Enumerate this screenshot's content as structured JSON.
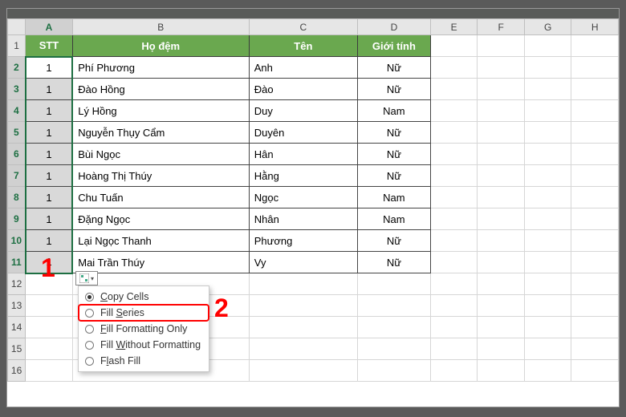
{
  "columns": [
    "A",
    "B",
    "C",
    "D",
    "E",
    "F",
    "G",
    "H"
  ],
  "rowNumbers": [
    1,
    2,
    3,
    4,
    5,
    6,
    7,
    8,
    9,
    10,
    11,
    12,
    13,
    14,
    15,
    16
  ],
  "headers": {
    "stt": "STT",
    "hodem": "Họ đệm",
    "ten": "Tên",
    "gioitinh": "Giới tính"
  },
  "rows": [
    {
      "stt": "1",
      "hodem": "Phí Phương",
      "ten": "Anh",
      "gt": "Nữ"
    },
    {
      "stt": "1",
      "hodem": "Đào Hồng",
      "ten": "Đào",
      "gt": "Nữ"
    },
    {
      "stt": "1",
      "hodem": "Lý Hồng",
      "ten": "Duy",
      "gt": "Nam"
    },
    {
      "stt": "1",
      "hodem": "Nguyễn Thụy Cẩm",
      "ten": "Duyên",
      "gt": "Nữ"
    },
    {
      "stt": "1",
      "hodem": "Bùi Ngọc",
      "ten": "Hân",
      "gt": "Nữ"
    },
    {
      "stt": "1",
      "hodem": "Hoàng Thị Thúy",
      "ten": "Hằng",
      "gt": "Nữ"
    },
    {
      "stt": "1",
      "hodem": "Chu Tuấn",
      "ten": "Ngọc",
      "gt": "Nam"
    },
    {
      "stt": "1",
      "hodem": "Đặng Ngọc",
      "ten": "Nhân",
      "gt": "Nam"
    },
    {
      "stt": "1",
      "hodem": "Lại Ngọc Thanh",
      "ten": "Phương",
      "gt": "Nữ"
    },
    {
      "stt": "1",
      "hodem": "Mai Trần Thúy",
      "ten": "Vy",
      "gt": "Nữ"
    }
  ],
  "autofillMenu": {
    "items": [
      {
        "label": "Copy Cells",
        "checked": true
      },
      {
        "label": "Fill Series",
        "checked": false
      },
      {
        "label": "Fill Formatting Only",
        "checked": false
      },
      {
        "label": "Fill Without Formatting",
        "checked": false
      },
      {
        "label": "Flash Fill",
        "checked": false
      }
    ]
  },
  "annotations": {
    "one": "1",
    "two": "2"
  },
  "colors": {
    "tableHeader": "#6aa84f",
    "selection": "#1d6f42",
    "anno": "#ff0000"
  }
}
